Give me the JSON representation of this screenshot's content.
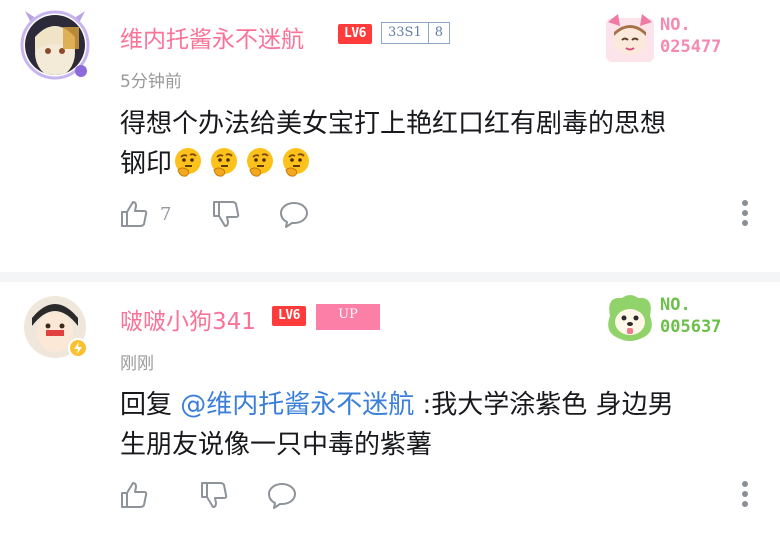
{
  "comments": [
    {
      "username": "维内托酱永不迷航",
      "level": "LV6",
      "medal": {
        "name": "33S1",
        "level": "8"
      },
      "timestamp": "5分钟前",
      "content_line1": "得想个办法给美女宝打上艳红口红有剧毒的思想",
      "content_line2": "钢印",
      "emoji_count": 4,
      "emoji_name": "thinking-face-emoji",
      "likes": "7",
      "fan_card": {
        "label": "NO.",
        "number": "025477",
        "color": "#f58ab0"
      }
    },
    {
      "username": "啵啵小狗341",
      "level": "LV6",
      "up_badge": "UP",
      "timestamp": "刚刚",
      "reply_prefix": "回复 ",
      "mention": "@维内托酱永不迷航",
      "content_line1_rest": " :我大学涂紫色 身边男",
      "content_line2": "生朋友说像一只中毒的紫薯",
      "likes": "",
      "fan_card": {
        "label": "NO.",
        "number": "005637",
        "color": "#6cc04a"
      }
    }
  ],
  "colors": {
    "username": "#fb7299",
    "mention": "#3b7fd9",
    "level_badge": "#ff3b3b",
    "muted": "#999999"
  }
}
